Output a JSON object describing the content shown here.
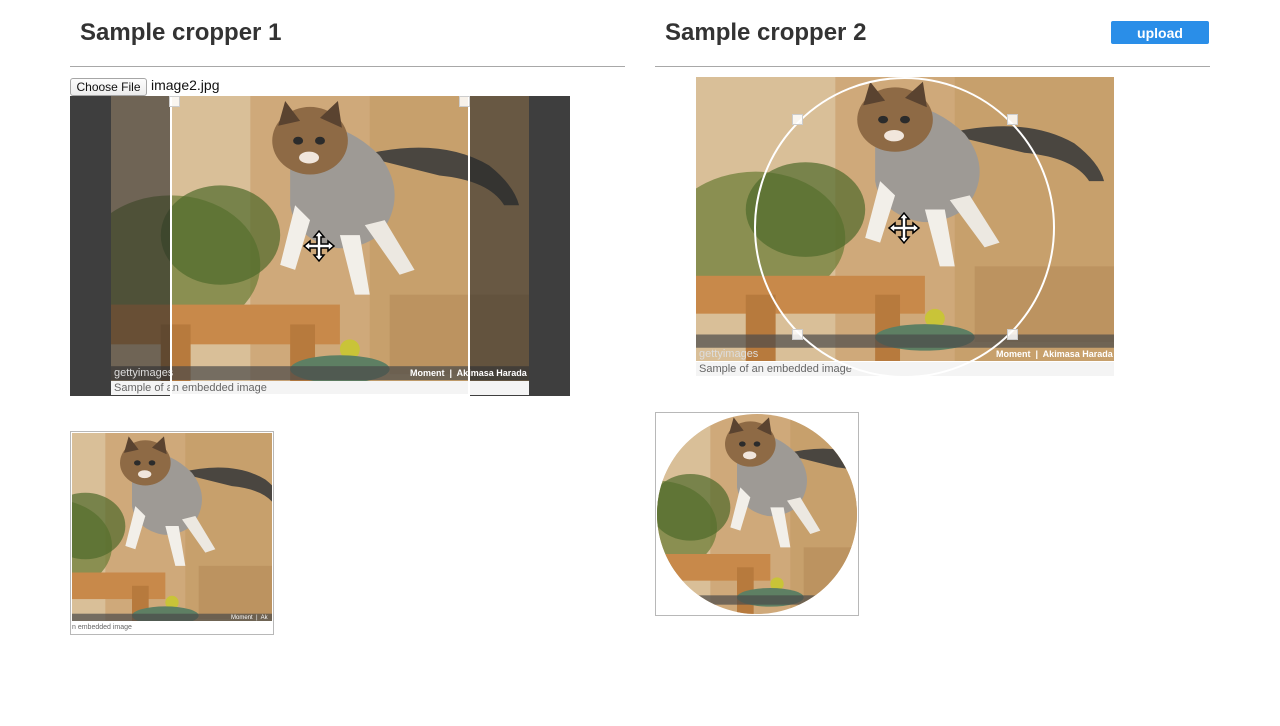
{
  "cropper1": {
    "title": "Sample cropper 1",
    "choose_file_label": "Choose File",
    "file_name": "image2.jpg",
    "caption": "Sample of an embedded image",
    "preview_caption": "n embedded image",
    "credit_brand": "gettyimages",
    "credit_text": "Moment  |  Akimasa Harada",
    "preview_credit": "Moment  |  Ak"
  },
  "cropper2": {
    "title": "Sample cropper 2",
    "upload_label": "upload",
    "caption": "Sample of an embedded image",
    "credit_brand": "gettyimages",
    "credit_text": "Moment  |  Akimasa Harada"
  }
}
